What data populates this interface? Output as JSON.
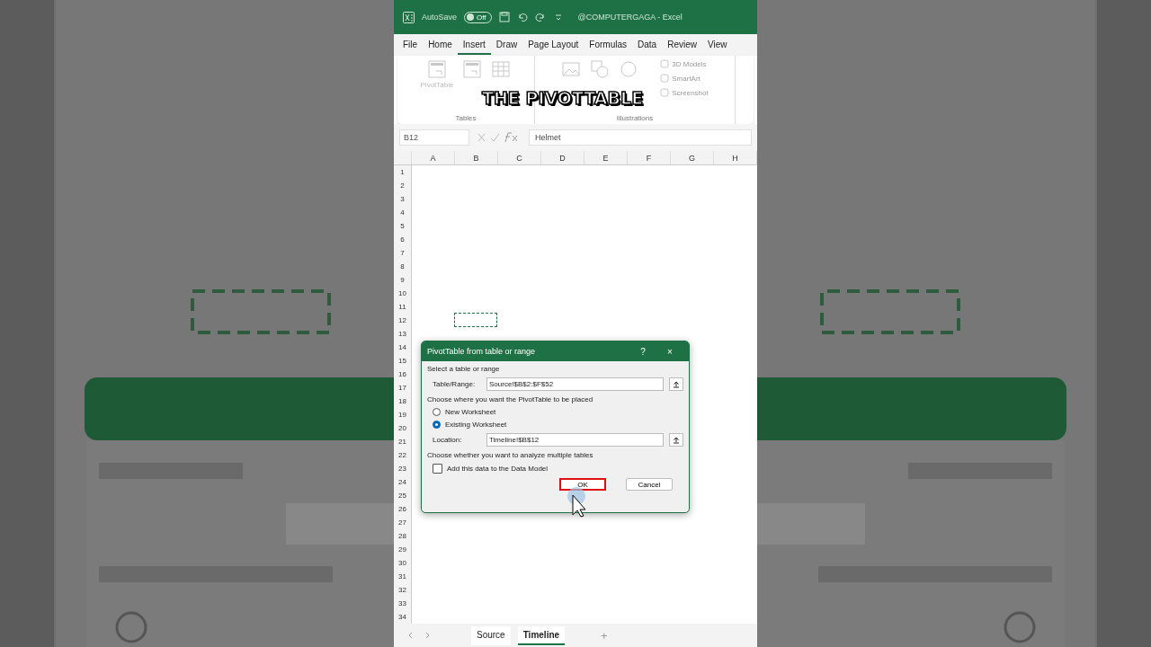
{
  "title_bar": {
    "autosave_label": "AutoSave",
    "autosave_toggle": {
      "label": "Off",
      "on": false
    },
    "title": "@COMPUTERGAGA  -  Excel"
  },
  "tabs": [
    {
      "label": "File",
      "selected": false
    },
    {
      "label": "Home",
      "selected": false
    },
    {
      "label": "Insert",
      "selected": true
    },
    {
      "label": "Draw",
      "selected": false
    },
    {
      "label": "Page Layout",
      "selected": false
    },
    {
      "label": "Formulas",
      "selected": false
    },
    {
      "label": "Data",
      "selected": false
    },
    {
      "label": "Review",
      "selected": false
    },
    {
      "label": "View",
      "selected": false
    }
  ],
  "ribbon": {
    "groups": [
      {
        "label": "Tables",
        "items": [
          {
            "label": "PivotTable",
            "disabled": true
          }
        ]
      },
      {
        "label": "Illustrations",
        "items": [
          {
            "label": "3D Models",
            "disabled": true
          },
          {
            "label": "SmartArt",
            "disabled": true
          },
          {
            "label": "Screenshot",
            "disabled": true
          }
        ]
      }
    ]
  },
  "caption": "THE PIVOTTABLE",
  "formula_bar": {
    "name_box": "B12",
    "value": "Helmet"
  },
  "grid": {
    "columns": [
      "A",
      "B",
      "C",
      "D",
      "E",
      "F",
      "G",
      "H"
    ],
    "rows": [
      "1",
      "2",
      "3",
      "4",
      "5",
      "6",
      "7",
      "8",
      "9",
      "10",
      "11",
      "12",
      "13",
      "14",
      "15",
      "16",
      "17",
      "18",
      "19",
      "20",
      "21",
      "22",
      "23",
      "24",
      "25",
      "26",
      "27",
      "28",
      "29",
      "30",
      "31",
      "32",
      "33",
      "34"
    ]
  },
  "dialog": {
    "title": "PivotTable from table or range",
    "help": "?",
    "close": "×",
    "section_1": "Select a table or range",
    "table_range": {
      "label": "Table/Range:",
      "value": "Source!$B$2:$F$52"
    },
    "section_2": "Choose where you want the PivotTable to be placed",
    "options": [
      {
        "label": "New Worksheet",
        "selected": false
      },
      {
        "label": "Existing Worksheet",
        "selected": true
      }
    ],
    "location": {
      "label": "Location:",
      "value": "Timeline!$B$12"
    },
    "section_3": "Choose whether you want to analyze multiple tables",
    "data_model": {
      "label": "Add this data to the Data Model",
      "checked": false
    },
    "buttons": [
      {
        "label": "OK",
        "focused": true
      },
      {
        "label": "Cancel",
        "focused": false
      }
    ]
  },
  "sheet_tabs": [
    {
      "label": "Source",
      "selected": false
    },
    {
      "label": "Timeline",
      "selected": true
    }
  ],
  "add_sheet": "+"
}
